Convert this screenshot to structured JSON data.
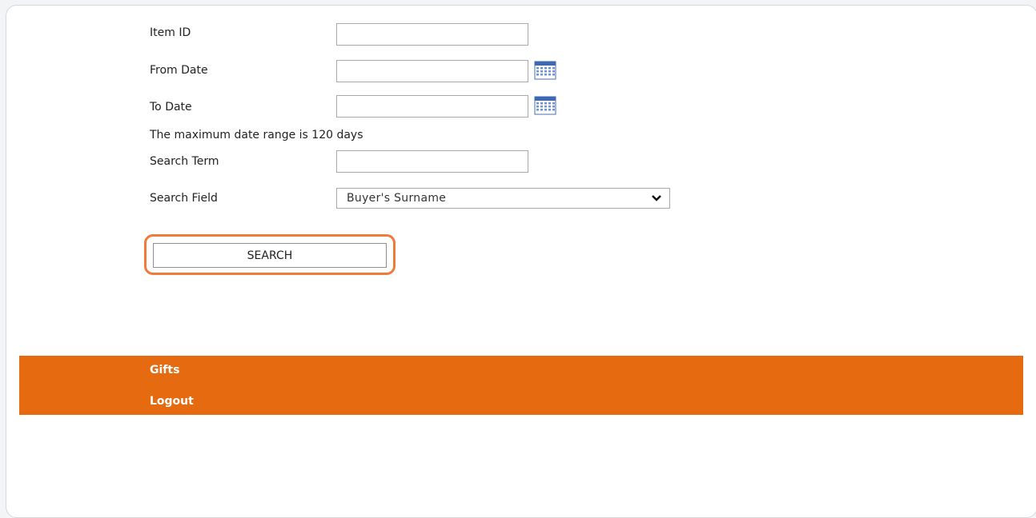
{
  "form": {
    "item_id_label": "Item ID",
    "item_id_value": "",
    "from_date_label": "From Date",
    "from_date_value": "",
    "to_date_label": "To Date",
    "to_date_value": "",
    "date_range_note": "The maximum date range is 120 days",
    "search_term_label": "Search Term",
    "search_term_value": "",
    "search_field_label": "Search Field",
    "search_field_selected": "Buyer's Surname",
    "search_button_label": "SEARCH"
  },
  "footer": {
    "links": [
      "Gifts",
      "Logout"
    ]
  },
  "colors": {
    "footer_bg": "#e66b10",
    "highlight": "#ee7a3c"
  },
  "icons": {
    "calendar": "calendar-icon",
    "dropdown": "chevron-down-icon"
  }
}
